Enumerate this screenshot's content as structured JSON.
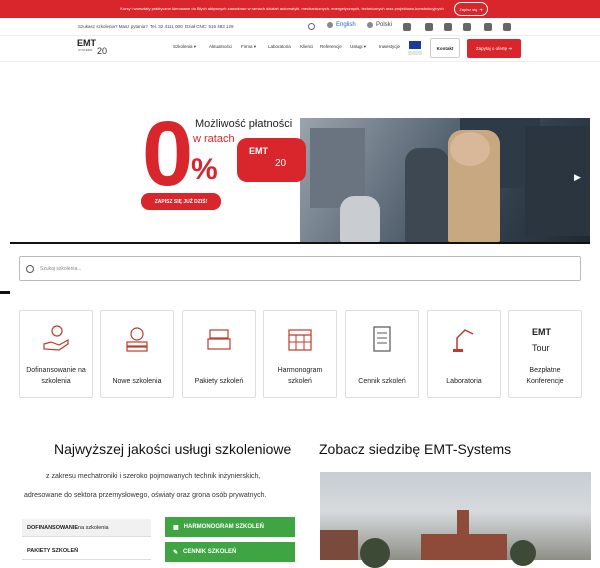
{
  "topbar": {
    "message": "Kursy i warsztaty praktyczne kierowane do Błych aktywnych zawodowo w ramach działań automatyki, mechanicznych, energetycznych, technicznych oraz projektowo-konstrukcyjnych",
    "cta": "Zapisz się"
  },
  "contact": {
    "question": "Szukasz szkolenia? Masz pytania?",
    "phone": "Tel. 32 4111 000",
    "cnc": "Dział CNC: 515 483 129"
  },
  "lang": {
    "en": "English",
    "pl": "Polski"
  },
  "logo": {
    "text": "EMT",
    "sub": "SYSTEMS",
    "years": "20"
  },
  "nav": [
    {
      "label": "Szkolenia ▾"
    },
    {
      "label": "Aktualności"
    },
    {
      "label": "Firma ▾"
    },
    {
      "label": "Laboratoria"
    },
    {
      "label": "Klienci"
    },
    {
      "label": "Referencje"
    },
    {
      "label": "Usługi ▾"
    },
    {
      "label": "Inwestycje"
    }
  ],
  "buttons": {
    "contact": "Kontakt",
    "offer": "Zapytaj o ofertę ➔"
  },
  "hero": {
    "zero": "0",
    "percent": "%",
    "line1": "Możliwość płatności",
    "line2": "w ratach",
    "signup": "ZAPISZ SIĘ JUŻ DZIŚ!"
  },
  "search": {
    "placeholder": "Szukaj szkolenia..."
  },
  "cards": [
    {
      "label": "Dofinansowanie na szkolenia",
      "icon": "funding-icon"
    },
    {
      "label": "Nowe szkolenia",
      "icon": "apple-books-icon"
    },
    {
      "label": "Pakiety szkoleń",
      "icon": "package-icon"
    },
    {
      "label": "Harmonogram szkoleń",
      "icon": "calendar-icon"
    },
    {
      "label": "Cennik szkoleń",
      "icon": "pricelist-icon"
    },
    {
      "label": "Laboratoria",
      "icon": "robot-arm-icon"
    },
    {
      "label": "Bezpłatne Konferencje",
      "icon": "emt-tour-icon"
    }
  ],
  "section": {
    "title_left": "Najwyższej jakości usługi szkoleniowe",
    "title_right": "Zobacz siedzibę EMT-Systems",
    "text1": "z zakresu mechatroniki i szeroko pojmowanych technik inżynierskich,",
    "text2": "adresowane do sektora przemysłowego, oświaty oraz grona osób prywatnych."
  },
  "list": [
    {
      "bold": "DOFINANSOWANIE",
      "rest": " na szkolenia"
    },
    {
      "bold": "",
      "rest": "PAKIETY SZKOLEŃ"
    }
  ],
  "green": [
    "HARMONOGRAM SZKOLEŃ",
    "CENNIK SZKOLEŃ"
  ],
  "colors": {
    "accent": "#d9262c",
    "green": "#3fa542"
  }
}
